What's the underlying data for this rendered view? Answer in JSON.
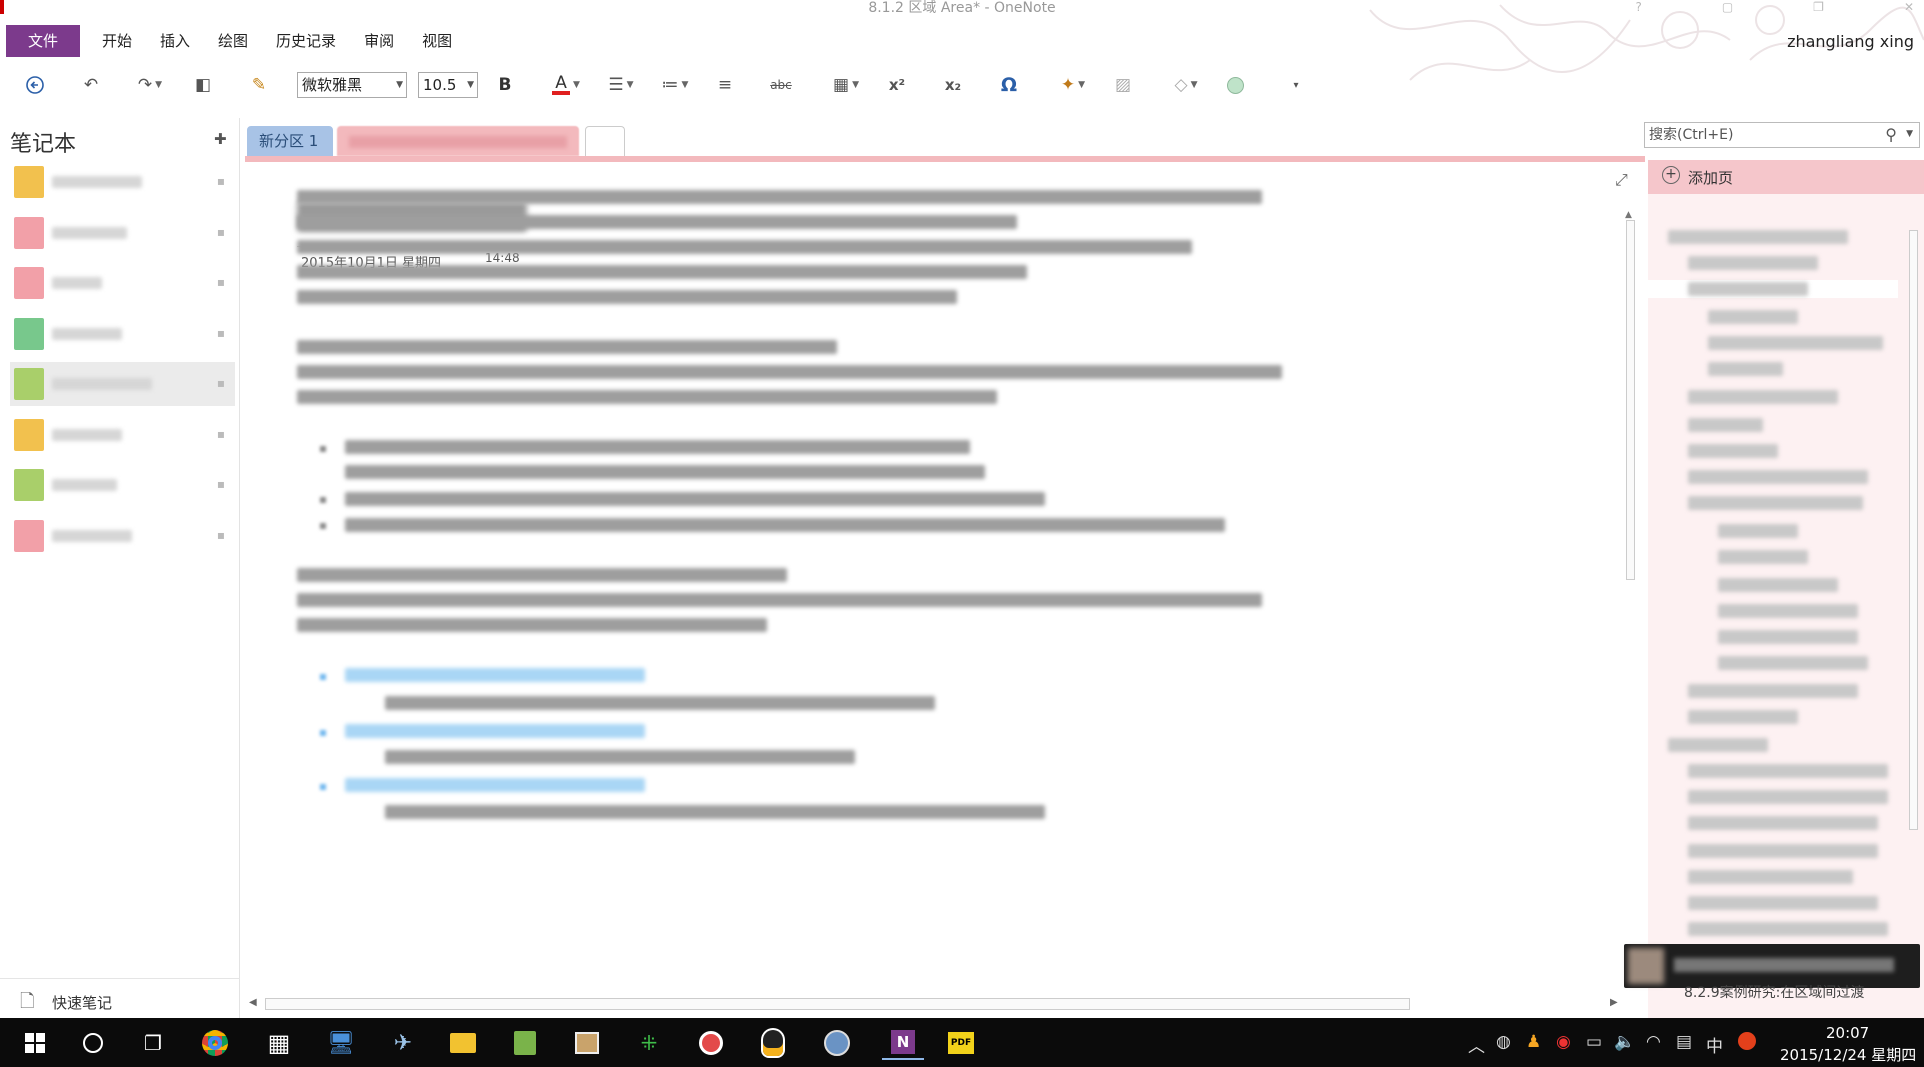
{
  "window": {
    "title": "8.1.2 区域 Area* - OneNote"
  },
  "ribbon": {
    "tabs": [
      "文件",
      "开始",
      "插入",
      "绘图",
      "历史记录",
      "审阅",
      "视图"
    ],
    "user": "zhangliang xing"
  },
  "toolbar": {
    "font_name": "微软雅黑",
    "font_size": "10.5",
    "bold_label": "B",
    "font_color_label": "A",
    "strike_label": "abc",
    "superscript_label": "x²",
    "subscript_label": "x₂",
    "symbol_label": "Ω",
    "colors": {
      "font_color_bar": "#e02020",
      "accent": "#7c3a8c"
    }
  },
  "notebooks": {
    "title": "笔记本",
    "items": [
      {
        "color": "#f2c14e"
      },
      {
        "color": "#f2a0a8"
      },
      {
        "color": "#f2a0a8"
      },
      {
        "color": "#78c88c"
      },
      {
        "color": "#a9cf6a",
        "selected": true
      },
      {
        "color": "#f2c14e"
      },
      {
        "color": "#a9cf6a"
      },
      {
        "color": "#f2a0a8"
      }
    ],
    "quick_notes": "快速笔记"
  },
  "sections": {
    "active": "新分区 1"
  },
  "page": {
    "date": "2015年10月1日 星期四",
    "time": "14:48"
  },
  "right_panel": {
    "search_placeholder": "搜索(Ctrl+E)",
    "add_page": "添加页",
    "last_page": "8.2.9案例研究:在区域间过渡"
  },
  "taskbar": {
    "ime": "中",
    "time": "20:07",
    "date": "2015/12/24 星期四"
  }
}
